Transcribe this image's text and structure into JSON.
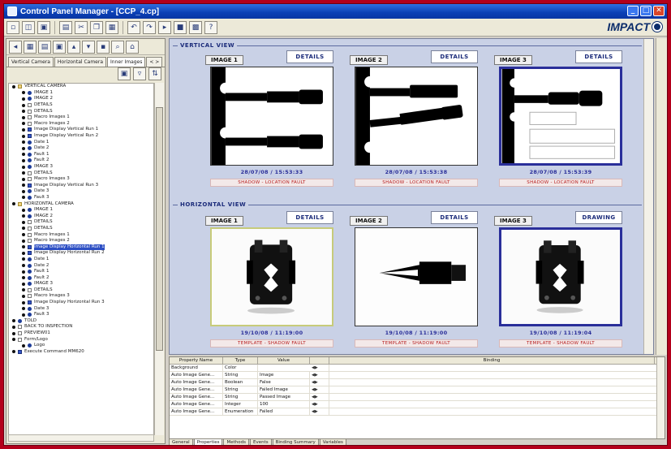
{
  "window": {
    "title": "Control Panel Manager - [CCP_4.cp]",
    "min_label": "_",
    "max_label": "□",
    "close_label": "✕",
    "brand": "IMPACT"
  },
  "toolbar": {
    "icons": [
      "new-icon",
      "open-icon",
      "save-icon",
      "print-icon",
      "cut-icon",
      "copy-icon",
      "paste-icon",
      "undo-icon",
      "redo-icon",
      "run-icon",
      "stop-icon",
      "help-icon"
    ]
  },
  "sidebar": {
    "tabs": [
      "Vertical Camera",
      "Horizontal Camera",
      "Inner Images",
      "< >"
    ],
    "tree": [
      {
        "label": "VERTICAL CAMERA",
        "type": "folder",
        "indent": 0
      },
      {
        "label": "IMAGE 1",
        "type": "node",
        "indent": 1
      },
      {
        "label": "IMAGE 2",
        "type": "node",
        "indent": 1
      },
      {
        "label": "DETAILS",
        "type": "leaf",
        "indent": 1
      },
      {
        "label": "DETAILS",
        "type": "leaf",
        "indent": 1
      },
      {
        "label": "Macro Images 1",
        "type": "leaf",
        "indent": 1
      },
      {
        "label": "Macro Images 2",
        "type": "leaf",
        "indent": 1
      },
      {
        "label": "Image Display Vertical Run 1",
        "type": "disp",
        "indent": 1
      },
      {
        "label": "Image Display Vertical Run 2",
        "type": "disp",
        "indent": 1
      },
      {
        "label": "Date 1",
        "type": "node",
        "indent": 1
      },
      {
        "label": "Date 2",
        "type": "node",
        "indent": 1
      },
      {
        "label": "Fault 1",
        "type": "node",
        "indent": 1
      },
      {
        "label": "Fault 2",
        "type": "node",
        "indent": 1
      },
      {
        "label": "IMAGE 3",
        "type": "node",
        "indent": 1
      },
      {
        "label": "DETAILS",
        "type": "leaf",
        "indent": 1
      },
      {
        "label": "Macro Images 3",
        "type": "leaf",
        "indent": 1
      },
      {
        "label": "Image Display Vertical Run 3",
        "type": "disp",
        "indent": 1
      },
      {
        "label": "Date 3",
        "type": "node",
        "indent": 1
      },
      {
        "label": "Fault 3",
        "type": "node",
        "indent": 1
      },
      {
        "label": "HORIZONTAL CAMERA",
        "type": "folder",
        "indent": 0
      },
      {
        "label": "IMAGE 1",
        "type": "node",
        "indent": 1
      },
      {
        "label": "IMAGE 2",
        "type": "node",
        "indent": 1
      },
      {
        "label": "DETAILS",
        "type": "leaf",
        "indent": 1
      },
      {
        "label": "DETAILS",
        "type": "leaf",
        "indent": 1
      },
      {
        "label": "Macro Images 1",
        "type": "leaf",
        "indent": 1
      },
      {
        "label": "Macro Images 2",
        "type": "leaf",
        "indent": 1
      },
      {
        "label": "Image Display Horizontal Run 1",
        "type": "disp",
        "indent": 1,
        "selected": true
      },
      {
        "label": "Image Display Horizontal Run 2",
        "type": "disp",
        "indent": 1
      },
      {
        "label": "Date 1",
        "type": "node",
        "indent": 1
      },
      {
        "label": "Date 2",
        "type": "node",
        "indent": 1
      },
      {
        "label": "Fault 1",
        "type": "node",
        "indent": 1
      },
      {
        "label": "Fault 2",
        "type": "node",
        "indent": 1
      },
      {
        "label": "IMAGE 3",
        "type": "node",
        "indent": 1
      },
      {
        "label": "DETAILS",
        "type": "leaf",
        "indent": 1
      },
      {
        "label": "Macro Images 3",
        "type": "leaf",
        "indent": 1
      },
      {
        "label": "Image Display Horizontal Run 3",
        "type": "disp",
        "indent": 1
      },
      {
        "label": "Date 3",
        "type": "node",
        "indent": 1
      },
      {
        "label": "Fault 3",
        "type": "node",
        "indent": 1
      },
      {
        "label": "TOLD",
        "type": "node",
        "indent": 0
      },
      {
        "label": "BACK TO INSPECTION",
        "type": "leaf",
        "indent": 0
      },
      {
        "label": "PREVIEW01",
        "type": "leaf",
        "indent": 0
      },
      {
        "label": "Form/Logo",
        "type": "leaf",
        "indent": 0
      },
      {
        "label": "Logo",
        "type": "node",
        "indent": 1
      },
      {
        "label": "Execute Command MM620",
        "type": "disp",
        "indent": 0
      }
    ]
  },
  "main": {
    "vertical_title": "VERTICAL VIEW",
    "horizontal_title": "HORIZONTAL VIEW",
    "vertical_panels": [
      {
        "tag": "IMAGE 1",
        "details": "DETAILS",
        "stamp": "28/07/08 / 15:53:33",
        "status": "SHADOW - LOCATION FAULT"
      },
      {
        "tag": "IMAGE 2",
        "details": "DETAILS",
        "stamp": "28/07/08 / 15:53:38",
        "status": "SHADOW - LOCATION FAULT"
      },
      {
        "tag": "IMAGE 3",
        "details": "DETAILS",
        "stamp": "28/07/08 / 15:53:39",
        "status": "SHADOW - LOCATION FAULT"
      }
    ],
    "horizontal_panels": [
      {
        "tag": "IMAGE 1",
        "details": "DETAILS",
        "stamp": "19/10/08 / 11:19:00",
        "status": "TEMPLATE - SHADOW FAULT"
      },
      {
        "tag": "IMAGE 2",
        "details": "DETAILS",
        "stamp": "19/10/08 / 11:19:00",
        "status": "TEMPLATE - SHADOW FAULT"
      },
      {
        "tag": "IMAGE 3",
        "details": "DRAWING",
        "stamp": "19/10/08 / 11:19:04",
        "status": "TEMPLATE - SHADOW FAULT"
      }
    ]
  },
  "properties": {
    "headers": [
      "Property Name",
      "Type",
      "Value",
      "",
      "Binding"
    ],
    "rows": [
      {
        "name": "Background",
        "type": "Color",
        "value": "",
        "binding": ""
      },
      {
        "name": "Auto Image Gene...",
        "type": "String",
        "value": "Image",
        "binding": ""
      },
      {
        "name": "Auto Image Gene...",
        "type": "Boolean",
        "value": "False",
        "binding": ""
      },
      {
        "name": "Auto Image Gene...",
        "type": "String",
        "value": "Failed Image",
        "binding": ""
      },
      {
        "name": "Auto Image Gene...",
        "type": "String",
        "value": "Passed Image",
        "binding": ""
      },
      {
        "name": "Auto Image Gene...",
        "type": "Integer",
        "value": "100",
        "binding": ""
      },
      {
        "name": "Auto Image Gene...",
        "type": "Enumeration",
        "value": "Failed",
        "binding": ""
      }
    ]
  },
  "bottom_tabs": [
    "General",
    "Properties",
    "Methods",
    "Events",
    "Binding Summary",
    "Variables"
  ]
}
